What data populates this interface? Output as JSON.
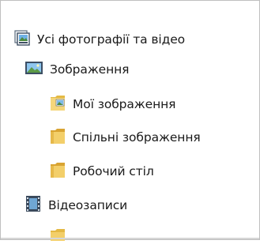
{
  "tree": {
    "items": [
      {
        "label": "Усі фотографії та відео",
        "icon": "photos-library-icon"
      },
      {
        "label": "Зображення",
        "icon": "pictures-library-icon"
      },
      {
        "label": "Мої зображення",
        "icon": "my-pictures-folder-icon"
      },
      {
        "label": "Спільні зображення",
        "icon": "folder-icon"
      },
      {
        "label": "Робочий стіл",
        "icon": "folder-icon"
      },
      {
        "label": "Відеозаписи",
        "icon": "videos-library-icon"
      }
    ]
  }
}
